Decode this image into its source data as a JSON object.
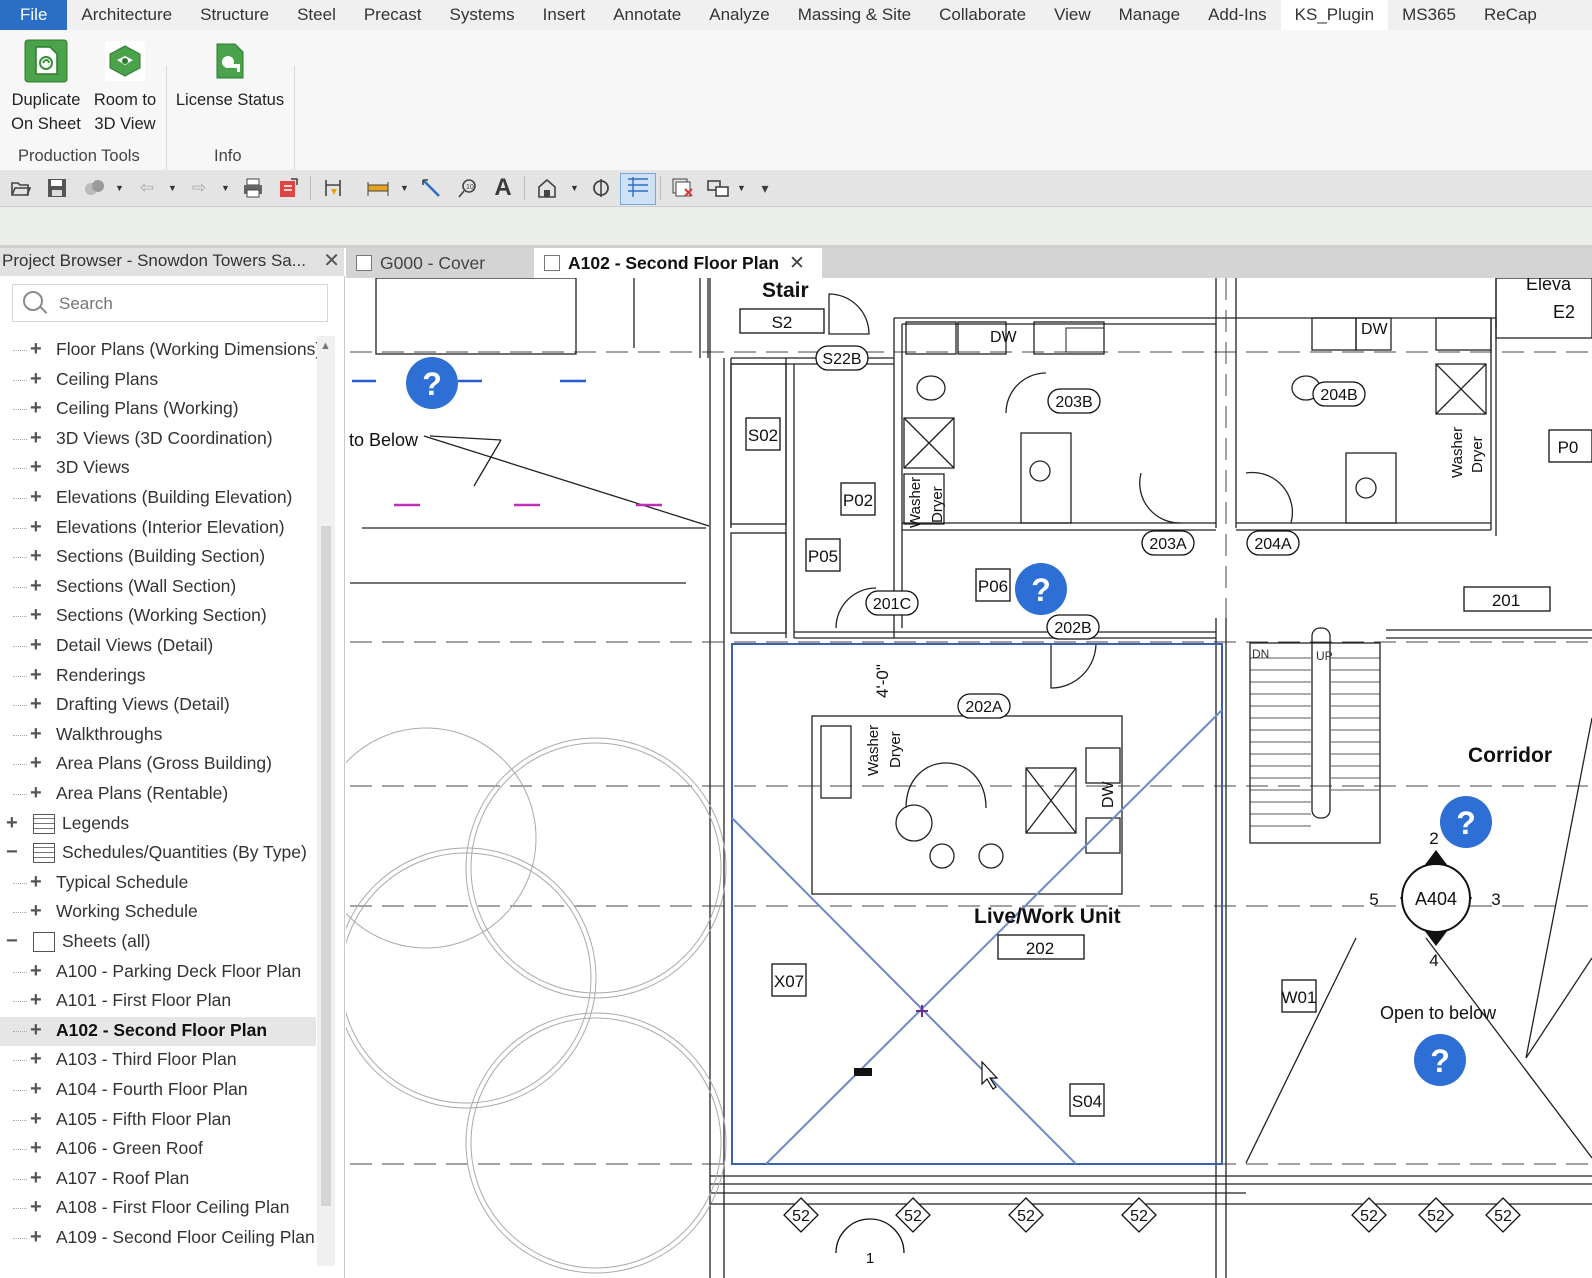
{
  "ribbon": {
    "tabs": [
      "File",
      "Architecture",
      "Structure",
      "Steel",
      "Precast",
      "Systems",
      "Insert",
      "Annotate",
      "Analyze",
      "Massing & Site",
      "Collaborate",
      "View",
      "Manage",
      "Add-Ins",
      "KS_Plugin",
      "MS365",
      "ReCap"
    ],
    "active_tab": "KS_Plugin",
    "buttons": {
      "duplicate_line1": "Duplicate",
      "duplicate_line2": "On Sheet",
      "room3d_line1": "Room to",
      "room3d_line2": "3D View",
      "license": "License Status"
    },
    "panels": {
      "production": "Production Tools",
      "info": "Info"
    }
  },
  "project_browser": {
    "title": "Project Browser - Snowdon Towers Sa...",
    "search_placeholder": "Search",
    "items": [
      {
        "label": "Floor Plans (Working Dimensions)",
        "indent": 1
      },
      {
        "label": "Ceiling Plans",
        "indent": 1
      },
      {
        "label": "Ceiling Plans (Working)",
        "indent": 1
      },
      {
        "label": "3D Views (3D Coordination)",
        "indent": 1
      },
      {
        "label": "3D Views",
        "indent": 1
      },
      {
        "label": "Elevations (Building Elevation)",
        "indent": 1
      },
      {
        "label": "Elevations (Interior Elevation)",
        "indent": 1
      },
      {
        "label": "Sections (Building Section)",
        "indent": 1
      },
      {
        "label": "Sections (Wall Section)",
        "indent": 1
      },
      {
        "label": "Sections (Working Section)",
        "indent": 1
      },
      {
        "label": "Detail Views (Detail)",
        "indent": 1
      },
      {
        "label": "Renderings",
        "indent": 1
      },
      {
        "label": "Drafting Views (Detail)",
        "indent": 1
      },
      {
        "label": "Walkthroughs",
        "indent": 1
      },
      {
        "label": "Area Plans (Gross Building)",
        "indent": 1
      },
      {
        "label": "Area Plans (Rentable)",
        "indent": 1
      },
      {
        "label": "Legends",
        "indent": 0,
        "icon": "legend"
      },
      {
        "label": "Schedules/Quantities (By Type)",
        "indent": 0,
        "icon": "schedule",
        "expanded": true
      },
      {
        "label": "Typical Schedule",
        "indent": 1
      },
      {
        "label": "Working Schedule",
        "indent": 1
      },
      {
        "label": "Sheets (all)",
        "indent": 0,
        "icon": "sheet",
        "expanded": true
      },
      {
        "label": "A100 - Parking Deck Floor Plan",
        "indent": 1
      },
      {
        "label": "A101 - First Floor Plan",
        "indent": 1
      },
      {
        "label": "A102 - Second Floor Plan",
        "indent": 1,
        "selected": true
      },
      {
        "label": "A103 - Third Floor Plan",
        "indent": 1
      },
      {
        "label": "A104 - Fourth Floor Plan",
        "indent": 1
      },
      {
        "label": "A105 - Fifth Floor Plan",
        "indent": 1
      },
      {
        "label": "A106 - Green Roof",
        "indent": 1
      },
      {
        "label": "A107 - Roof Plan",
        "indent": 1
      },
      {
        "label": "A108 - First Floor Ceiling Plan",
        "indent": 1
      },
      {
        "label": "A109 - Second Floor Ceiling Plan",
        "indent": 1
      }
    ]
  },
  "doc_tabs": [
    {
      "label": "G000 - Cover",
      "active": false
    },
    {
      "label": "A102 - Second Floor Plan",
      "active": true
    }
  ],
  "plan": {
    "stair_label": "Stair",
    "stair_num": "S2",
    "corridor_label": "Corridor",
    "corridor_num": "201",
    "livework_label": "Live/Work Unit",
    "livework_num": "202",
    "to_below": "to Below",
    "open_to_below": "Open to below",
    "elev_partial": "Eleva",
    "e2_partial": "E2",
    "p0_partial": "P0",
    "tags": {
      "s22b": "S22B",
      "s02": "S02",
      "p02": "P02",
      "p05": "P05",
      "p06": "P06",
      "t203b": "203B",
      "t204b": "204B",
      "t203a": "203A",
      "t204a": "204A",
      "t201c": "201C",
      "t202b": "202B",
      "t202a": "202A",
      "x07": "X07",
      "w01": "W01",
      "s04": "S04"
    },
    "fixture_text": {
      "dw": "DW",
      "washer": "Washer",
      "dryer": "Dryer"
    },
    "dimension": "4'-0\"",
    "stair_dn": "DN",
    "stair_up": "UP",
    "elevation_marker": {
      "ref": "A404",
      "n": "2",
      "e": "3",
      "s": "4",
      "w": "5"
    },
    "grid_bubble": "52",
    "section_bubble": "1",
    "help_glyph": "?"
  },
  "colors": {
    "accent": "#2a6ec6",
    "help": "#2e6fd6",
    "selection": "#2b4fa8"
  }
}
